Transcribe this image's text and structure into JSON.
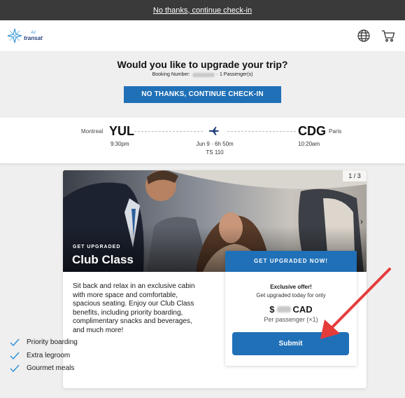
{
  "topbar": {
    "link": "No thanks, continue check-in"
  },
  "logo": {
    "air": "Air",
    "transat": "transat"
  },
  "hero": {
    "title": "Would you like to upgrade your trip?",
    "booking_label": "Booking Number:",
    "booking_suffix": "· 1 Passenger(s)",
    "cta": "NO THANKS, CONTINUE CHECK-IN"
  },
  "flight": {
    "origin_city": "Montreal",
    "origin_code": "YUL",
    "origin_time": "9:30pm",
    "dest_city": "Paris",
    "dest_code": "CDG",
    "dest_time": "10:20am",
    "date_duration": "Jun 9 · 6h 50m",
    "flight_number": "TS 110"
  },
  "card": {
    "counter": "1 / 3",
    "eyebrow": "GET UPGRADED",
    "class_name": "Club Class",
    "description": "Sit back and relax in an exclusive cabin with more space and comfortable, spacious seating. Enjoy our Club Class benefits, including priority boarding, complimentary snacks and beverages, and much more!",
    "features": [
      "Priority boarding",
      "Extra legroom",
      "Gourmet meals"
    ]
  },
  "offer": {
    "header": "GET UPGRADED NOW!",
    "exclusive": "Exclusive offer!",
    "today": "Get upgraded today for only",
    "price_prefix": "$",
    "currency": "CAD",
    "per_passenger": "Per passenger (×1)",
    "submit": "Submit"
  },
  "colors": {
    "primary": "#1f70b7",
    "topbar": "#3a3a3a",
    "check": "#2b8fd6",
    "annotation_arrow": "#e53b3b"
  },
  "icons": [
    "air-transat-logo-icon",
    "globe-icon",
    "cart-icon",
    "plane-icon",
    "chevron-right-icon",
    "checkmark-icon",
    "red-arrow-icon"
  ]
}
